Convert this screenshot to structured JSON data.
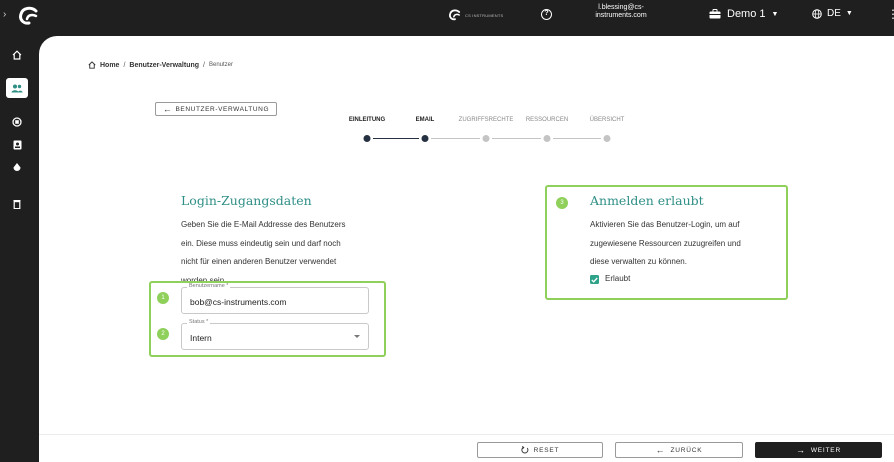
{
  "topbar": {
    "brand_text": "CS INSTRUMENTS",
    "user_line1": "l.blessing@cs-",
    "user_line2": "instruments.com",
    "workspace": "Demo 1",
    "language": "DE"
  },
  "sidebar": {
    "items": [
      {
        "icon": "home-icon"
      },
      {
        "icon": "users-icon",
        "active": true
      },
      {
        "icon": "device-icon"
      },
      {
        "icon": "badge-icon"
      },
      {
        "icon": "drop-icon"
      },
      {
        "icon": "trash-icon"
      }
    ]
  },
  "breadcrumb": {
    "home": "Home",
    "sep1": "/",
    "section": "Benutzer-Verwaltung",
    "sep2": "/",
    "current": "Benutzer"
  },
  "back_button": {
    "label": "BENUTZER-VERWALTUNG"
  },
  "stepper": {
    "steps": [
      {
        "label": "EINLEITUNG",
        "done": true
      },
      {
        "label": "EMAIL",
        "done": true
      },
      {
        "label": "ZUGRIFFSRECHTE",
        "done": false
      },
      {
        "label": "RESSOURCEN",
        "done": false
      },
      {
        "label": "ÜBERSICHT",
        "done": false
      }
    ]
  },
  "login": {
    "title": "Login-Zugangsdaten",
    "description_lines": [
      "Geben Sie die E-Mail Addresse des Benutzers",
      "ein. Diese muss eindeutig sein und darf noch",
      "nicht für einen anderen Benutzer verwendet",
      "worden sein."
    ],
    "username_label": "Benutzername *",
    "username_value": "bob@cs-instruments.com",
    "status_label": "Status *",
    "status_value": "Intern",
    "badge1": "1",
    "badge2": "2"
  },
  "login_allowed": {
    "title": "Anmelden erlaubt",
    "description_lines": [
      "Aktivieren Sie das Benutzer-Login, um auf",
      "zugewiesene Ressourcen zuzugreifen und",
      "diese verwalten zu können."
    ],
    "checkbox_label": "Erlaubt",
    "checked": true,
    "badge": "3"
  },
  "footer": {
    "reset": "RESET",
    "back": "ZURÜCK",
    "next": "WEITER"
  },
  "colors": {
    "accent": "#2f8f86",
    "highlight": "#8fd05b",
    "dark": "#1f1f1f",
    "checkbox": "#2fa38a"
  }
}
